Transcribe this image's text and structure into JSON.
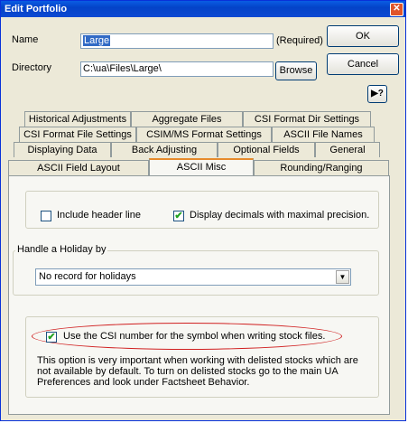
{
  "window": {
    "title": "Edit Portfolio",
    "close_glyph": "✕"
  },
  "fields": {
    "name_label": "Name",
    "name_value": "Large",
    "required_label": "(Required)",
    "directory_label": "Directory",
    "directory_value": "C:\\ua\\Files\\Large\\",
    "browse_label": "Browse"
  },
  "buttons": {
    "ok": "OK",
    "cancel": "Cancel",
    "help_icon": "help-cursor-icon",
    "help_glyph": "▶?"
  },
  "tabs": {
    "row1": [
      "Historical Adjustments",
      "Aggregate Files",
      "CSI Format Dir Settings"
    ],
    "row2": [
      "CSI Format File Settings",
      "CSIM/MS Format Settings",
      "ASCII File Names"
    ],
    "row3": [
      "Displaying Data",
      "Back Adjusting",
      "Optional Fields",
      "General"
    ],
    "row4": [
      "ASCII Field Layout",
      "ASCII Misc",
      "Rounding/Ranging"
    ],
    "active": "ASCII Misc"
  },
  "options": {
    "include_header": {
      "label": "Include header line",
      "checked": false
    },
    "display_decimals": {
      "label": "Display decimals with maximal precision.",
      "checked": true,
      "check_glyph": "✔"
    }
  },
  "holiday": {
    "legend": "Handle a Holiday by",
    "selected": "No record for holidays",
    "arrow_glyph": "▼"
  },
  "csi_symbol": {
    "label": "Use the CSI number for the symbol when writing stock files.",
    "checked": true,
    "check_glyph": "✔",
    "info": "This option is very important when working with delisted stocks which are not available by default.  To turn on delisted stocks go to the main UA Preferences and look under Factsheet Behavior.",
    "highlight_color": "#d02020"
  }
}
